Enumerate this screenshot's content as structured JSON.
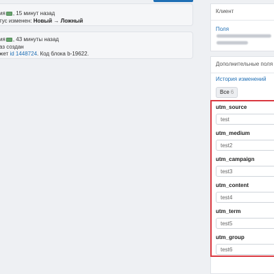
{
  "feed": [
    {
      "author_partial": "ия",
      "time": ", 15 минут назад",
      "status_prefix": "тус изменен:",
      "status_change": "Новый → Ложный"
    },
    {
      "author_partial": "ия",
      "time": ", 43 минуты назад",
      "line2": "аз создан",
      "line3_prefix": "жет",
      "ticket_link": "id 1448724",
      "line3_suffix": ". Код блока b-19622."
    }
  ],
  "client_panel": {
    "title": "Клиент",
    "fields_link": "Поля"
  },
  "extra_panel": {
    "title": "Дополнительные поля",
    "history_link": "История изменений",
    "all_button_label": "Все",
    "all_button_count": "6"
  },
  "utm_fields": [
    {
      "label": "utm_source",
      "value": "test"
    },
    {
      "label": "utm_medium",
      "value": "test2"
    },
    {
      "label": "utm_campaign",
      "value": "test3"
    },
    {
      "label": "utm_content",
      "value": "test4"
    },
    {
      "label": "utm_term",
      "value": "test5"
    },
    {
      "label": "utm_group",
      "value": "test6"
    }
  ],
  "colors": {
    "accent": "#1f6fb5",
    "highlight_border": "#d9363e",
    "background": "#eef0f3"
  }
}
